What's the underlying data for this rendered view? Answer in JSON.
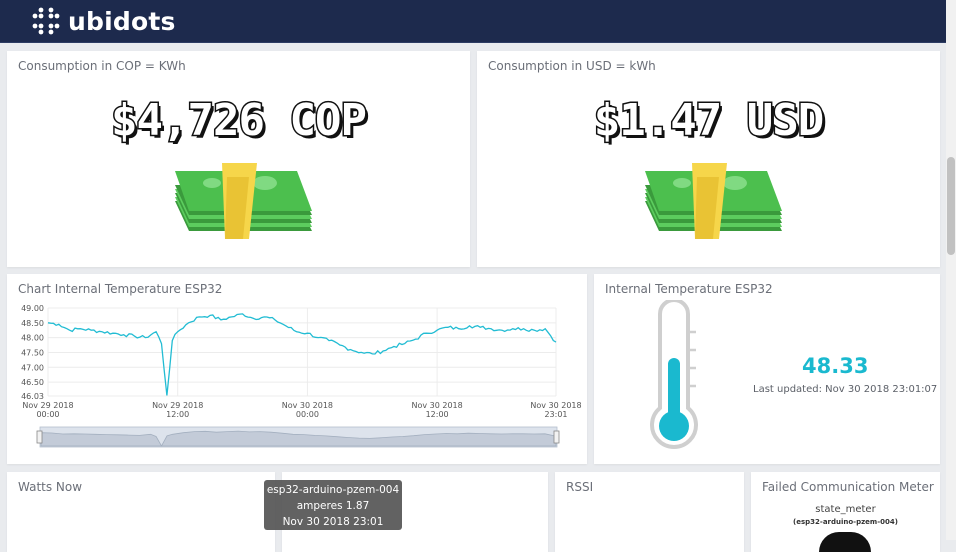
{
  "header": {
    "logo_text": "ubidots"
  },
  "cards": {
    "cop": {
      "title": "Consumption in COP = KWh",
      "value": "$4,726 COP",
      "image_icon": "money-stack-icon"
    },
    "usd": {
      "title": "Consumption in USD = kWh",
      "value": "$1.47 USD",
      "image_icon": "money-stack-icon"
    },
    "chart": {
      "title": "Chart Internal Temperature ESP32"
    },
    "temperature": {
      "title": "Internal Temperature ESP32",
      "value": "48.33",
      "last_updated": "Last updated: Nov 30 2018 23:01:07",
      "icon": "thermometer-icon"
    },
    "watts": {
      "title": "Watts Now"
    },
    "rssi": {
      "title": "RSSI"
    },
    "failed": {
      "title": "Failed Communication Meter",
      "variable": "state_meter",
      "device": "(esp32-arduino-pzem-004)"
    }
  },
  "tooltip": {
    "device": "esp32-arduino-pzem-004",
    "reading": "amperes 1.87",
    "time": "Nov 30 2018 23:01"
  },
  "colors": {
    "header_bg": "#1d2a4d",
    "accent": "#1ab9cf",
    "line": "#22bcd3",
    "money_green": "#4cbf4e",
    "money_band": "#f6d64a"
  },
  "chart_data": {
    "type": "line",
    "title": "Chart Internal Temperature ESP32",
    "xlabel": "",
    "ylabel": "",
    "ylim": [
      46.03,
      49.0
    ],
    "y_ticks": [
      "49.00",
      "48.50",
      "48.00",
      "47.50",
      "47.00",
      "46.50",
      "46.03"
    ],
    "x_ticks": [
      {
        "line1": "Nov 29 2018",
        "line2": "00:00"
      },
      {
        "line1": "Nov 29 2018",
        "line2": "12:00"
      },
      {
        "line1": "Nov 30 2018",
        "line2": "00:00"
      },
      {
        "line1": "Nov 30 2018",
        "line2": "12:00"
      },
      {
        "line1": "Nov 30 2018",
        "line2": "23:01"
      }
    ],
    "x_hours": [
      0,
      1,
      2,
      3,
      4,
      5,
      6,
      7,
      8,
      9,
      10,
      10.5,
      11,
      11.5,
      12,
      13,
      14,
      15,
      16,
      17,
      18,
      19,
      20,
      21,
      22,
      23,
      24,
      25,
      26,
      27,
      28,
      29,
      30,
      31,
      32,
      33,
      34,
      35,
      36,
      37,
      38,
      39,
      40,
      41,
      42,
      43,
      44,
      45,
      46,
      47
    ],
    "values": [
      48.5,
      48.45,
      48.25,
      48.3,
      48.25,
      48.2,
      48.15,
      48.1,
      48.05,
      48.0,
      48.2,
      47.8,
      46.05,
      47.9,
      48.2,
      48.5,
      48.7,
      48.75,
      48.6,
      48.7,
      48.8,
      48.65,
      48.7,
      48.6,
      48.4,
      48.2,
      48.15,
      48.0,
      47.9,
      47.75,
      47.6,
      47.5,
      47.45,
      47.55,
      47.7,
      47.8,
      47.95,
      48.15,
      48.25,
      48.35,
      48.3,
      48.4,
      48.35,
      48.3,
      48.25,
      48.3,
      48.3,
      48.25,
      48.3,
      47.85
    ]
  }
}
